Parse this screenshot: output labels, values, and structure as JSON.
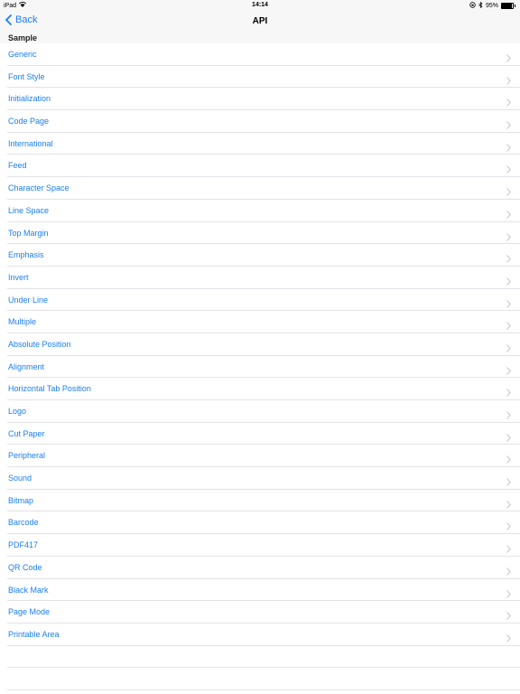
{
  "status_bar": {
    "device": "iPad",
    "time": "14:14",
    "battery_percent_label": "95%",
    "battery_level": 0.95
  },
  "nav": {
    "back_label": "Back",
    "title": "API"
  },
  "section": {
    "title": "Sample"
  },
  "items": [
    {
      "label": "Generic"
    },
    {
      "label": "Font Style"
    },
    {
      "label": "Initialization"
    },
    {
      "label": "Code Page"
    },
    {
      "label": "International"
    },
    {
      "label": "Feed"
    },
    {
      "label": "Character Space"
    },
    {
      "label": "Line Space"
    },
    {
      "label": "Top Margin"
    },
    {
      "label": "Emphasis"
    },
    {
      "label": "Invert"
    },
    {
      "label": "Under Line"
    },
    {
      "label": "Multiple"
    },
    {
      "label": "Absolute Position"
    },
    {
      "label": "Alignment"
    },
    {
      "label": "Horizontal Tab Position"
    },
    {
      "label": "Logo"
    },
    {
      "label": "Cut Paper"
    },
    {
      "label": "Peripheral"
    },
    {
      "label": "Sound"
    },
    {
      "label": "Bitmap"
    },
    {
      "label": "Barcode"
    },
    {
      "label": "PDF417"
    },
    {
      "label": "QR Code"
    },
    {
      "label": "Black Mark"
    },
    {
      "label": "Page Mode"
    },
    {
      "label": "Printable Area"
    }
  ],
  "colors": {
    "accent": "#1a7ef2",
    "separator": "#e3e3e7",
    "bar_background": "#f7f7f7"
  },
  "icons": {
    "back": "chevron-left-icon",
    "row_disclosure": "chevron-right-icon",
    "wifi": "wifi-icon",
    "rotation_lock": "rotation-lock-icon",
    "bluetooth": "bluetooth-icon",
    "battery": "battery-icon"
  }
}
